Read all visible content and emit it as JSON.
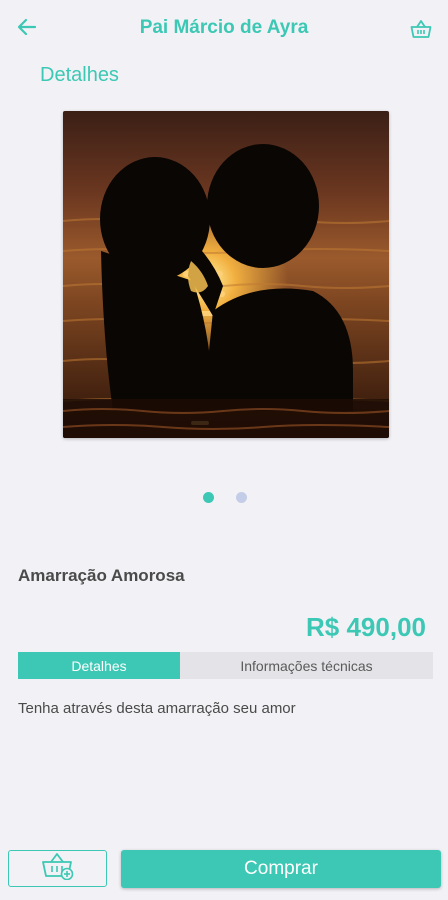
{
  "header": {
    "title": "Pai Márcio de Ayra",
    "back_icon": "arrow-left-icon",
    "cart_icon": "basket-icon"
  },
  "section": {
    "title": "Detalhes"
  },
  "gallery": {
    "image": "silhouette-couple-kissing-sunset-water",
    "dots_count": 2,
    "active_index": 0
  },
  "product": {
    "name": "Amarração Amorosa",
    "price": "R$ 490,00"
  },
  "tabs": [
    {
      "label": "Detalhes",
      "active": true
    },
    {
      "label": "Informações técnicas",
      "active": false
    }
  ],
  "description": "Tenha através desta amarração seu amor",
  "actions": {
    "add_to_cart_icon": "basket-plus-icon",
    "buy_label": "Comprar"
  },
  "colors": {
    "accent": "#3cc8b4",
    "background": "#f2f2f6",
    "text": "#4a4a4a",
    "dot_inactive": "#c4cde8"
  }
}
